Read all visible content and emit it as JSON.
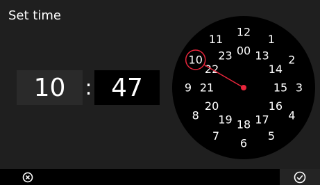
{
  "title": "Set time",
  "time": {
    "hours": "10",
    "separator": ":",
    "minutes": "47"
  },
  "clock": {
    "selected_hour": 10,
    "outer_labels": [
      "12",
      "1",
      "2",
      "3",
      "4",
      "5",
      "6",
      "7",
      "8",
      "9",
      "10",
      "11"
    ],
    "inner_labels": [
      "00",
      "13",
      "14",
      "15",
      "16",
      "17",
      "18",
      "19",
      "20",
      "21",
      "22",
      "23"
    ]
  },
  "colors": {
    "background": "#1f1f1f",
    "dial": "#000000",
    "accent": "#e8253b",
    "text": "#ffffff"
  },
  "icons": {
    "cancel": "close-circle-icon",
    "confirm": "check-circle-icon"
  }
}
